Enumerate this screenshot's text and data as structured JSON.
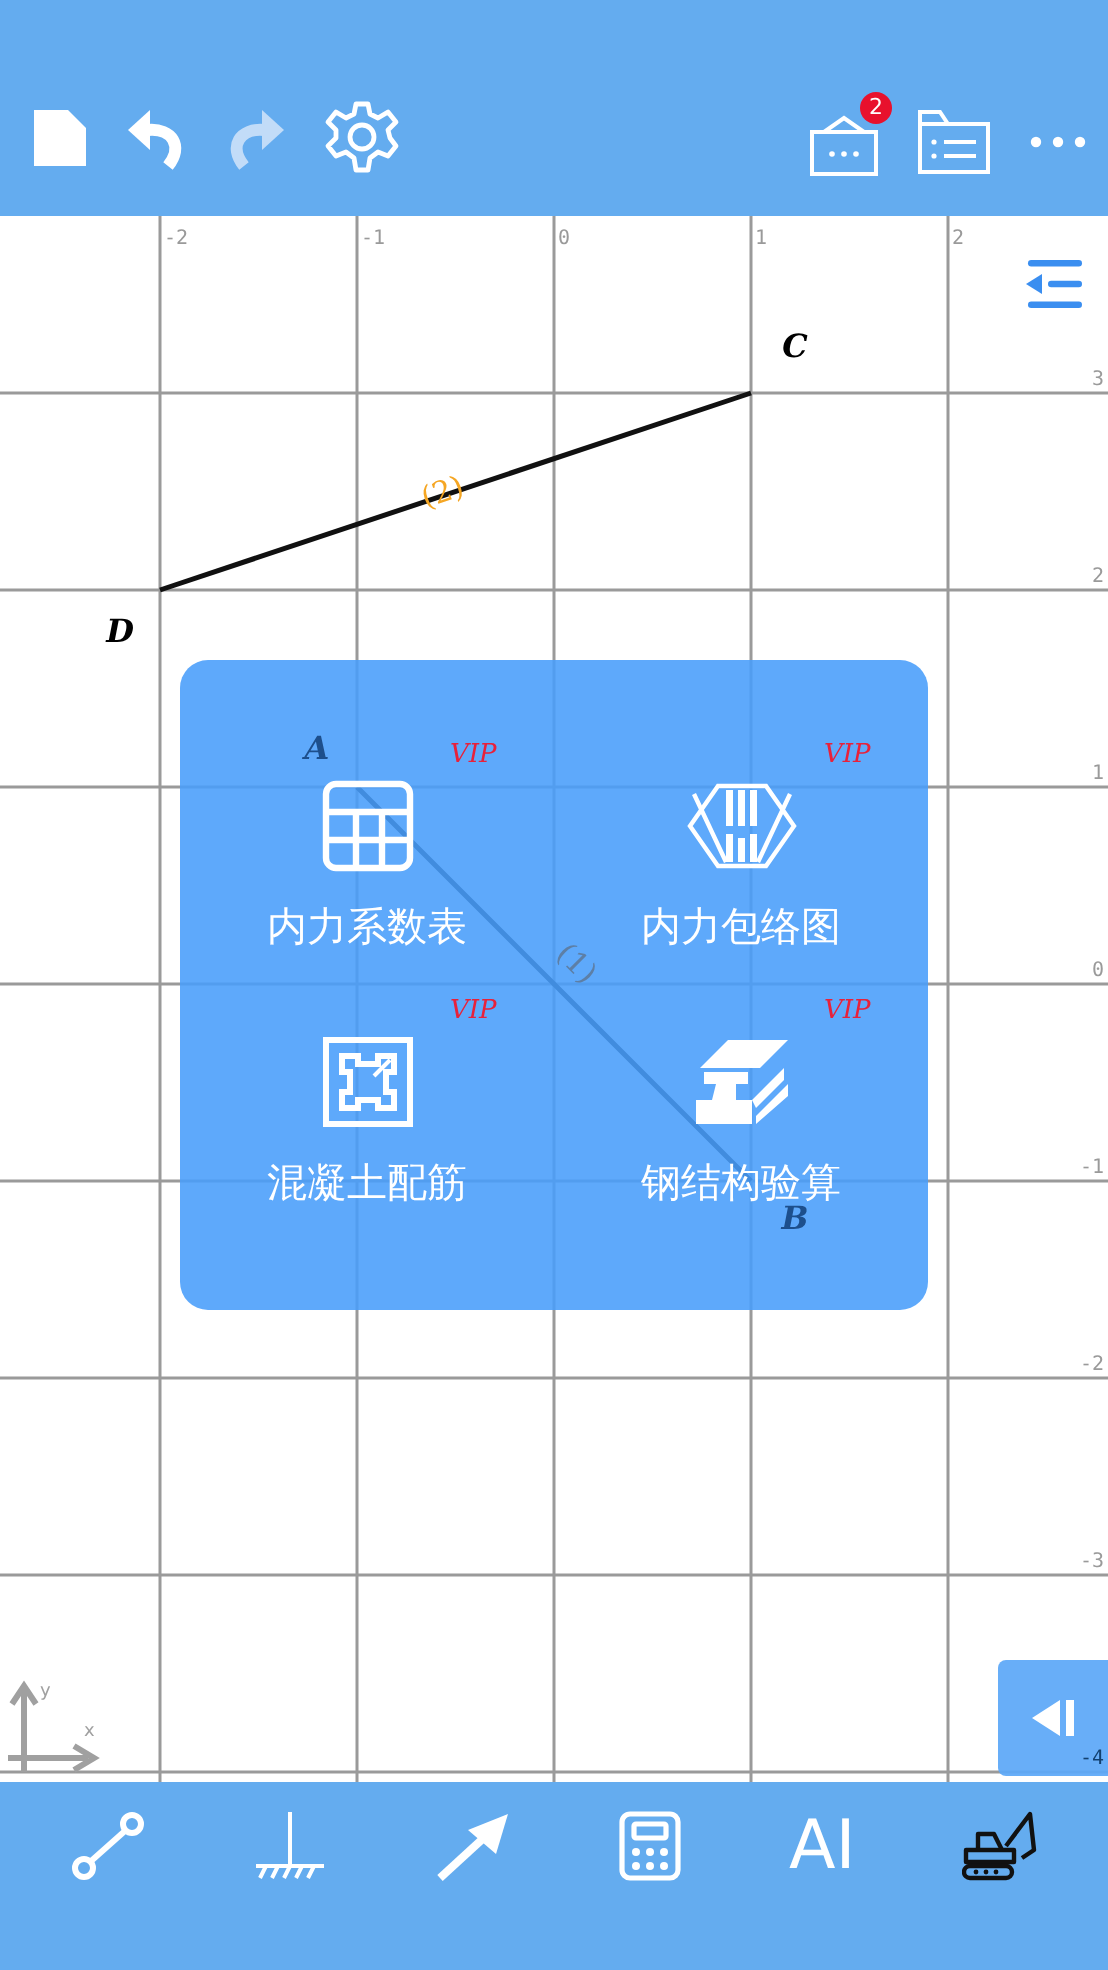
{
  "toolbar": {
    "undo": {
      "disabled": false
    },
    "redo": {
      "disabled": true
    },
    "inbox_badge": "2"
  },
  "canvas": {
    "x_ticks": [
      "-2",
      "-1",
      "0",
      "1",
      "2"
    ],
    "y_ticks": [
      "3",
      "2",
      "1",
      "0",
      "-1",
      "-2",
      "-3",
      "-4"
    ],
    "axis": {
      "x_label": "x",
      "y_label": "y"
    },
    "nodes": [
      {
        "label": "C"
      },
      {
        "label": "D"
      },
      {
        "label": "A"
      },
      {
        "label": "B"
      }
    ],
    "members": [
      {
        "label": "(2)",
        "color": "#f5a623"
      },
      {
        "label": "(1)",
        "color": "#5d7fa6"
      }
    ]
  },
  "menu": {
    "items": [
      {
        "kind": "coefficient_table",
        "label": "内力系数表",
        "badge": "VIP"
      },
      {
        "kind": "envelope_diagram",
        "label": "内力包络图",
        "badge": "VIP"
      },
      {
        "kind": "concrete_rebar",
        "label": "混凝土配筋",
        "badge": "VIP"
      },
      {
        "kind": "steel_check",
        "label": "钢结构验算",
        "badge": "VIP"
      }
    ]
  },
  "bottom_toolbar": [
    {
      "kind": "member"
    },
    {
      "kind": "support"
    },
    {
      "kind": "load"
    },
    {
      "kind": "calculator"
    },
    {
      "kind": "text",
      "text": "AI"
    },
    {
      "kind": "excavator"
    }
  ]
}
